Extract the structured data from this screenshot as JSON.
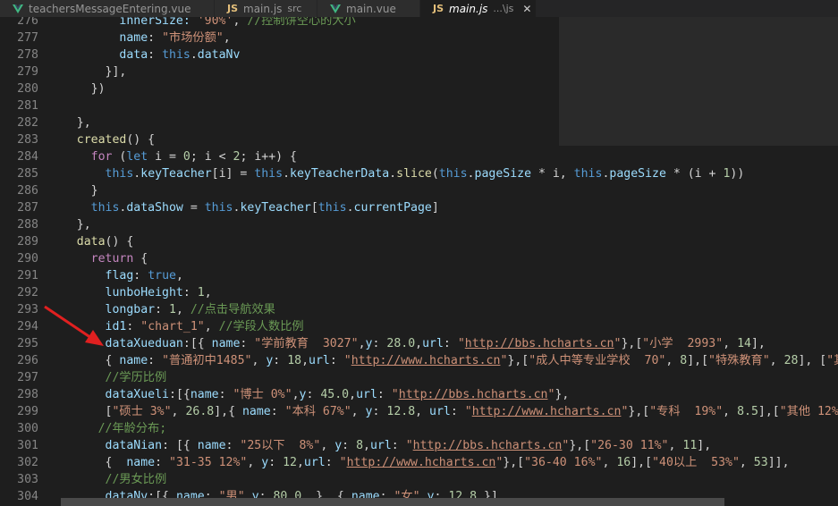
{
  "tabs": [
    {
      "icon": "vue-icon",
      "label": "teachersMessageEntering.vue",
      "sub": ""
    },
    {
      "icon": "js-icon",
      "label": "main.js",
      "sub": "src"
    },
    {
      "icon": "vue-icon",
      "label": "main.vue",
      "sub": ""
    },
    {
      "icon": "js-icon",
      "label": "main.js",
      "sub": "...\\js"
    }
  ],
  "colors": {
    "keyword": "#569cd6",
    "property": "#9cdcfe",
    "string": "#ce9178",
    "number": "#b5cea8",
    "comment": "#6a9955",
    "function": "#dcdcaa",
    "control": "#c586c0",
    "arrow": "#e02020"
  },
  "lines": [
    {
      "n": "276",
      "segs": [
        [
          "          innerSize: ",
          "p"
        ],
        [
          "'90%'",
          "s"
        ],
        [
          ", ",
          ""
        ],
        [
          "//控制饼空心的大小",
          "cm"
        ]
      ]
    },
    {
      "n": "277",
      "segs": [
        [
          "          ",
          ""
        ],
        [
          "name",
          "p"
        ],
        [
          ": ",
          ""
        ],
        [
          "\"市场份额\"",
          "s"
        ],
        [
          ",",
          ""
        ]
      ]
    },
    {
      "n": "278",
      "segs": [
        [
          "          ",
          ""
        ],
        [
          "data",
          "p"
        ],
        [
          ": ",
          ""
        ],
        [
          "this",
          "k"
        ],
        [
          ".",
          ""
        ],
        [
          "dataNv",
          "p"
        ]
      ]
    },
    {
      "n": "279",
      "segs": [
        [
          "        }],",
          ""
        ]
      ]
    },
    {
      "n": "280",
      "segs": [
        [
          "      })",
          ""
        ]
      ]
    },
    {
      "n": "281",
      "segs": [
        [
          "",
          ""
        ]
      ]
    },
    {
      "n": "282",
      "segs": [
        [
          "    },",
          ""
        ]
      ]
    },
    {
      "n": "283",
      "segs": [
        [
          "    ",
          ""
        ],
        [
          "created",
          "f"
        ],
        [
          "() {",
          ""
        ]
      ]
    },
    {
      "n": "284",
      "segs": [
        [
          "      ",
          ""
        ],
        [
          "for",
          "c"
        ],
        [
          " (",
          ""
        ],
        [
          "let",
          "k"
        ],
        [
          " i = ",
          ""
        ],
        [
          "0",
          "n"
        ],
        [
          "; i < ",
          ""
        ],
        [
          "2",
          "n"
        ],
        [
          "; i++) {",
          ""
        ]
      ]
    },
    {
      "n": "285",
      "segs": [
        [
          "        ",
          ""
        ],
        [
          "this",
          "k"
        ],
        [
          ".",
          ""
        ],
        [
          "keyTeacher",
          "p"
        ],
        [
          "[i] = ",
          ""
        ],
        [
          "this",
          "k"
        ],
        [
          ".",
          ""
        ],
        [
          "keyTeacherData",
          "p"
        ],
        [
          ".",
          ""
        ],
        [
          "slice",
          "f"
        ],
        [
          "(",
          ""
        ],
        [
          "this",
          "k"
        ],
        [
          ".",
          ""
        ],
        [
          "pageSize",
          "p"
        ],
        [
          " * i, ",
          ""
        ],
        [
          "this",
          "k"
        ],
        [
          ".",
          ""
        ],
        [
          "pageSize",
          "p"
        ],
        [
          " * (i + ",
          ""
        ],
        [
          "1",
          "n"
        ],
        [
          "))",
          ""
        ]
      ]
    },
    {
      "n": "286",
      "segs": [
        [
          "      }",
          ""
        ]
      ]
    },
    {
      "n": "287",
      "segs": [
        [
          "      ",
          ""
        ],
        [
          "this",
          "k"
        ],
        [
          ".",
          ""
        ],
        [
          "dataShow",
          "p"
        ],
        [
          " = ",
          ""
        ],
        [
          "this",
          "k"
        ],
        [
          ".",
          ""
        ],
        [
          "keyTeacher",
          "p"
        ],
        [
          "[",
          ""
        ],
        [
          "this",
          "k"
        ],
        [
          ".",
          ""
        ],
        [
          "currentPage",
          "p"
        ],
        [
          "]",
          ""
        ]
      ]
    },
    {
      "n": "288",
      "segs": [
        [
          "    },",
          ""
        ]
      ]
    },
    {
      "n": "289",
      "segs": [
        [
          "    ",
          ""
        ],
        [
          "data",
          "f"
        ],
        [
          "() {",
          ""
        ]
      ]
    },
    {
      "n": "290",
      "segs": [
        [
          "      ",
          ""
        ],
        [
          "return",
          "c"
        ],
        [
          " {",
          ""
        ]
      ]
    },
    {
      "n": "291",
      "segs": [
        [
          "        ",
          ""
        ],
        [
          "flag",
          "p"
        ],
        [
          ": ",
          ""
        ],
        [
          "true",
          "k"
        ],
        [
          ",",
          ""
        ]
      ]
    },
    {
      "n": "292",
      "segs": [
        [
          "        ",
          ""
        ],
        [
          "lunboHeight",
          "p"
        ],
        [
          ": ",
          ""
        ],
        [
          "1",
          "n"
        ],
        [
          ",",
          ""
        ]
      ]
    },
    {
      "n": "293",
      "segs": [
        [
          "        ",
          ""
        ],
        [
          "longbar",
          "p"
        ],
        [
          ": ",
          ""
        ],
        [
          "1",
          "n"
        ],
        [
          ", ",
          ""
        ],
        [
          "//点击导航效果",
          "cm"
        ]
      ]
    },
    {
      "n": "294",
      "segs": [
        [
          "        ",
          ""
        ],
        [
          "id1",
          "p"
        ],
        [
          ": ",
          ""
        ],
        [
          "\"chart_1\"",
          "s"
        ],
        [
          ", ",
          ""
        ],
        [
          "//学段人数比例",
          "cm"
        ]
      ]
    },
    {
      "n": "295",
      "segs": [
        [
          "        ",
          ""
        ],
        [
          "dataXueduan",
          "p"
        ],
        [
          ":[{ ",
          ""
        ],
        [
          "name",
          "p"
        ],
        [
          ": ",
          ""
        ],
        [
          "\"学前教育  3027\"",
          "s"
        ],
        [
          ",",
          ""
        ],
        [
          "y",
          "p"
        ],
        [
          ": ",
          ""
        ],
        [
          "28.0",
          "n"
        ],
        [
          ",",
          ""
        ],
        [
          "url",
          "p"
        ],
        [
          ": ",
          ""
        ],
        [
          "\"",
          "s"
        ],
        [
          "http://bbs.hcharts.cn",
          "u"
        ],
        [
          "\"",
          "s"
        ],
        [
          "},[",
          ""
        ],
        [
          "\"小学  2993\"",
          "s"
        ],
        [
          ", ",
          ""
        ],
        [
          "14",
          "n"
        ],
        [
          "],",
          ""
        ]
      ]
    },
    {
      "n": "296",
      "segs": [
        [
          "        { ",
          ""
        ],
        [
          "name",
          "p"
        ],
        [
          ": ",
          ""
        ],
        [
          "\"普通初中1485\"",
          "s"
        ],
        [
          ", ",
          ""
        ],
        [
          "y",
          "p"
        ],
        [
          ": ",
          ""
        ],
        [
          "18",
          "n"
        ],
        [
          ",",
          ""
        ],
        [
          "url",
          "p"
        ],
        [
          ": ",
          ""
        ],
        [
          "\"",
          "s"
        ],
        [
          "http://www.hcharts.cn",
          "u"
        ],
        [
          "\"",
          "s"
        ],
        [
          "},[",
          ""
        ],
        [
          "\"成人中等专业学校  70\"",
          "s"
        ],
        [
          ", ",
          ""
        ],
        [
          "8",
          "n"
        ],
        [
          "],[",
          ""
        ],
        [
          "\"特殊教育\"",
          "s"
        ],
        [
          ", ",
          ""
        ],
        [
          "28",
          "n"
        ],
        [
          "], [",
          ""
        ],
        [
          "\"其",
          "s"
        ]
      ]
    },
    {
      "n": "297",
      "segs": [
        [
          "        ",
          ""
        ],
        [
          "//学历比例",
          "cm"
        ]
      ]
    },
    {
      "n": "298",
      "segs": [
        [
          "        ",
          ""
        ],
        [
          "dataXueli",
          "p"
        ],
        [
          ":[{",
          ""
        ],
        [
          "name",
          "p"
        ],
        [
          ": ",
          ""
        ],
        [
          "\"博士 0%\"",
          "s"
        ],
        [
          ",",
          ""
        ],
        [
          "y",
          "p"
        ],
        [
          ": ",
          ""
        ],
        [
          "45.0",
          "n"
        ],
        [
          ",",
          ""
        ],
        [
          "url",
          "p"
        ],
        [
          ": ",
          ""
        ],
        [
          "\"",
          "s"
        ],
        [
          "http://bbs.hcharts.cn",
          "u"
        ],
        [
          "\"",
          "s"
        ],
        [
          "},",
          ""
        ]
      ]
    },
    {
      "n": "299",
      "segs": [
        [
          "        [",
          ""
        ],
        [
          "\"硕士 3%\"",
          "s"
        ],
        [
          ", ",
          ""
        ],
        [
          "26.8",
          "n"
        ],
        [
          "],{ ",
          ""
        ],
        [
          "name",
          "p"
        ],
        [
          ": ",
          ""
        ],
        [
          "\"本科 67%\"",
          "s"
        ],
        [
          ", ",
          ""
        ],
        [
          "y",
          "p"
        ],
        [
          ": ",
          ""
        ],
        [
          "12.8",
          "n"
        ],
        [
          ", ",
          ""
        ],
        [
          "url",
          "p"
        ],
        [
          ": ",
          ""
        ],
        [
          "\"",
          "s"
        ],
        [
          "http://www.hcharts.cn",
          "u"
        ],
        [
          "\"",
          "s"
        ],
        [
          "},[",
          ""
        ],
        [
          "\"专科  19%\"",
          "s"
        ],
        [
          ", ",
          ""
        ],
        [
          "8.5",
          "n"
        ],
        [
          "],[",
          ""
        ],
        [
          "\"其他 12%\"",
          "s"
        ],
        [
          ",",
          ""
        ]
      ]
    },
    {
      "n": "300",
      "segs": [
        [
          "       ",
          ""
        ],
        [
          "//年龄分布;",
          "cm"
        ]
      ]
    },
    {
      "n": "301",
      "segs": [
        [
          "        ",
          ""
        ],
        [
          "dataNian",
          "p"
        ],
        [
          ": [{ ",
          ""
        ],
        [
          "name",
          "p"
        ],
        [
          ": ",
          ""
        ],
        [
          "\"25以下  8%\"",
          "s"
        ],
        [
          ", ",
          ""
        ],
        [
          "y",
          "p"
        ],
        [
          ": ",
          ""
        ],
        [
          "8",
          "n"
        ],
        [
          ",",
          ""
        ],
        [
          "url",
          "p"
        ],
        [
          ": ",
          ""
        ],
        [
          "\"",
          "s"
        ],
        [
          "http://bbs.hcharts.cn",
          "u"
        ],
        [
          "\"",
          "s"
        ],
        [
          "},[",
          ""
        ],
        [
          "\"26-30 11%\"",
          "s"
        ],
        [
          ", ",
          ""
        ],
        [
          "11",
          "n"
        ],
        [
          "],",
          ""
        ]
      ]
    },
    {
      "n": "302",
      "segs": [
        [
          "        {  ",
          ""
        ],
        [
          "name",
          "p"
        ],
        [
          ": ",
          ""
        ],
        [
          "\"31-35 12%\"",
          "s"
        ],
        [
          ", ",
          ""
        ],
        [
          "y",
          "p"
        ],
        [
          ": ",
          ""
        ],
        [
          "12",
          "n"
        ],
        [
          ",",
          ""
        ],
        [
          "url",
          "p"
        ],
        [
          ": ",
          ""
        ],
        [
          "\"",
          "s"
        ],
        [
          "http://www.hcharts.cn",
          "u"
        ],
        [
          "\"",
          "s"
        ],
        [
          "},[",
          ""
        ],
        [
          "\"36-40 16%\"",
          "s"
        ],
        [
          ", ",
          ""
        ],
        [
          "16",
          "n"
        ],
        [
          "],[",
          ""
        ],
        [
          "\"40以上  53%\"",
          "s"
        ],
        [
          ", ",
          ""
        ],
        [
          "53",
          "n"
        ],
        [
          "]],",
          ""
        ]
      ]
    },
    {
      "n": "303",
      "segs": [
        [
          "        ",
          ""
        ],
        [
          "//男女比例",
          "cm"
        ]
      ]
    },
    {
      "n": "304",
      "segs": [
        [
          "        ",
          ""
        ],
        [
          "dataNv",
          "p"
        ],
        [
          ":[{ ",
          ""
        ],
        [
          "name",
          "p"
        ],
        [
          ": ",
          ""
        ],
        [
          "\"男\"",
          "s"
        ],
        [
          ",",
          ""
        ],
        [
          "y",
          "p"
        ],
        [
          ": ",
          ""
        ],
        [
          "80.0",
          "n"
        ],
        [
          ", }, { ",
          ""
        ],
        [
          "name",
          "p"
        ],
        [
          ": ",
          ""
        ],
        [
          "\"女\"",
          "s"
        ],
        [
          ",",
          ""
        ],
        [
          "y",
          "p"
        ],
        [
          ": ",
          ""
        ],
        [
          "12.8",
          "n"
        ],
        [
          ",}],",
          ""
        ]
      ]
    }
  ]
}
